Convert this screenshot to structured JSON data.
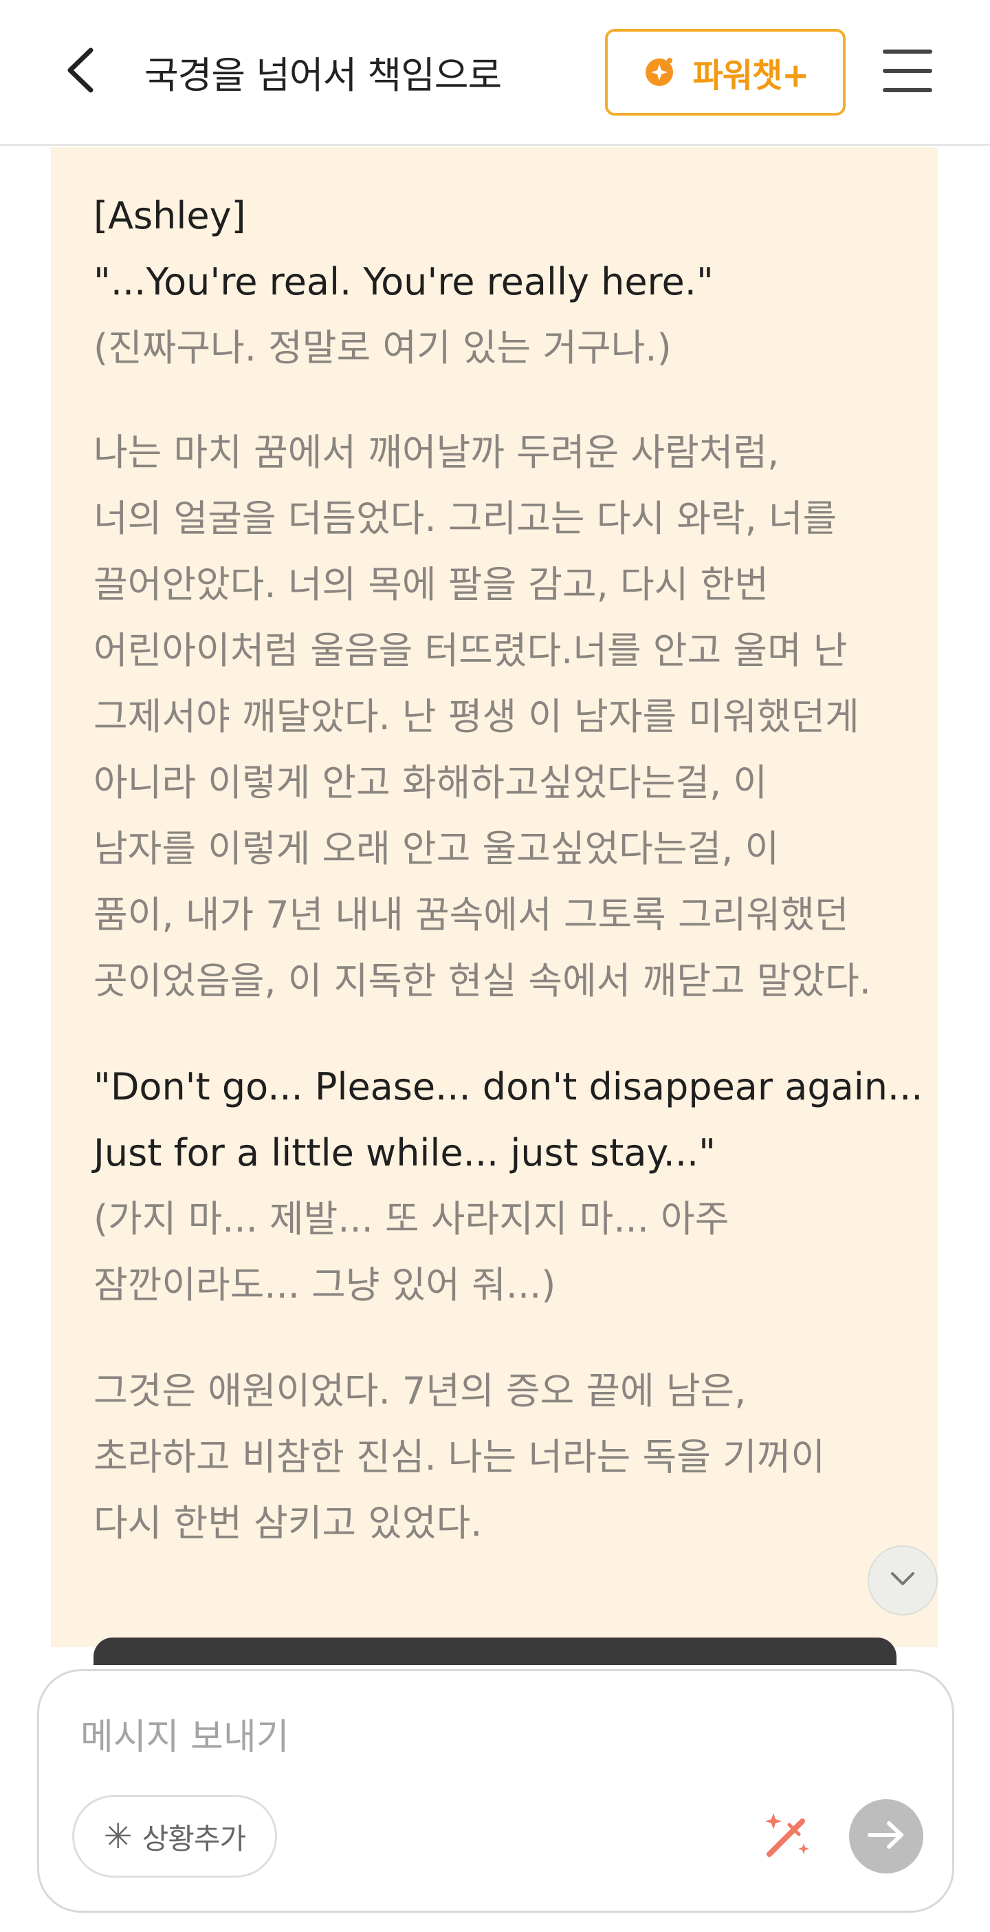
{
  "header": {
    "title": "국경을 넘어서 책임으로",
    "power_chat_label": "파워챗+",
    "back_icon": "chevron-left-icon",
    "menu_icon": "hamburger-menu-icon",
    "accent_color": "#f29a12"
  },
  "chat": {
    "background_color": "#fef3e1",
    "paragraphs": [
      {
        "kind": "mixed",
        "lines": [
          {
            "style": "en",
            "text": "[Ashley]"
          },
          {
            "style": "en",
            "text": "\"...You're real. You're really here.\""
          },
          {
            "style": "ko",
            "text": "(진짜구나. 정말로 여기 있는 거구나.)"
          }
        ]
      },
      {
        "kind": "narration",
        "lines": [
          {
            "style": "ko",
            "text": "나는 마치 꿈에서 깨어날까 두려운 사람처럼,"
          },
          {
            "style": "ko",
            "text": "너의 얼굴을 더듬었다. 그리고는 다시 와락, 너를"
          },
          {
            "style": "ko",
            "text": "끌어안았다. 너의 목에 팔을 감고, 다시 한번"
          },
          {
            "style": "ko",
            "text": "어린아이처럼 울음을 터뜨렸다.너를 안고 울며 난"
          },
          {
            "style": "ko",
            "text": "그제서야 깨달았다. 난 평생 이 남자를 미워했던게"
          },
          {
            "style": "ko",
            "text": "아니라 이렇게 안고 화해하고싶었다는걸, 이"
          },
          {
            "style": "ko",
            "text": "남자를 이렇게 오래 안고 울고싶었다는걸, 이"
          },
          {
            "style": "ko",
            "text": "품이, 내가 7년 내내 꿈속에서 그토록 그리워했던"
          },
          {
            "style": "ko",
            "text": "곳이었음을, 이 지독한 현실 속에서 깨닫고 말았다."
          }
        ]
      },
      {
        "kind": "mixed",
        "lines": [
          {
            "style": "en",
            "text": "\"Don't go... Please... don't disappear again..."
          },
          {
            "style": "en",
            "text": "Just for a little while... just stay...\""
          },
          {
            "style": "ko",
            "text": "(가지 마... 제발... 또 사라지지 마... 아주"
          },
          {
            "style": "ko",
            "text": "잠깐이라도... 그냥 있어 줘...)"
          }
        ]
      },
      {
        "kind": "narration",
        "lines": [
          {
            "style": "ko",
            "text": "그것은 애원이었다. 7년의 증오 끝에 남은,"
          },
          {
            "style": "ko",
            "text": "초라하고 비참한 진심. 나는 너라는 독을 기꺼이"
          },
          {
            "style": "ko",
            "text": "다시 한번 삼키고 있었다."
          }
        ]
      }
    ],
    "scroll_down_icon": "chevron-down-icon"
  },
  "composer": {
    "placeholder": "메시지 보내기",
    "value": "",
    "situation_label": "상황추가",
    "situation_icon": "asterisk-icon",
    "magic_icon": "magic-wand-icon",
    "magic_color": "#f07a64",
    "send_icon": "arrow-right-icon",
    "send_color": "#bdbdbd"
  }
}
